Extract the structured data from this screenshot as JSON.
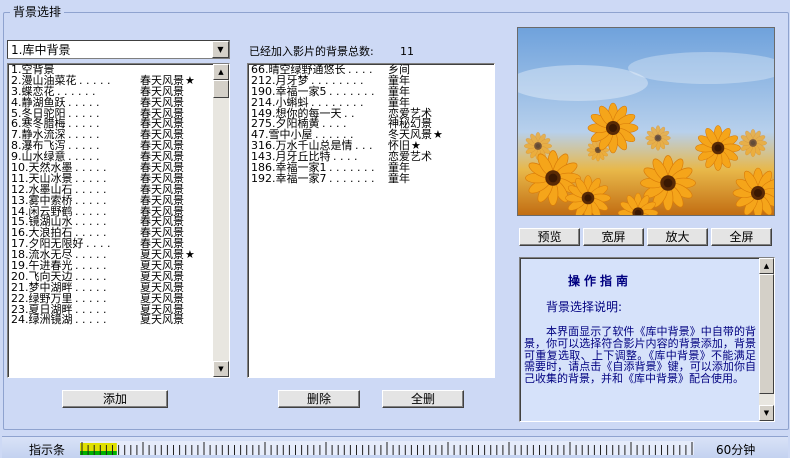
{
  "group_title": "背景选排",
  "combo": {
    "selected": "1.库中背景"
  },
  "library_list": [
    {
      "title": "1.空背景",
      "dots": "",
      "category": "",
      "star": false
    },
    {
      "title": "2.漫山油菜花",
      "dots": ". . . . .",
      "category": "春天风景",
      "star": true
    },
    {
      "title": "3.蝶恋花",
      "dots": ". . . . . .",
      "category": "春天风景",
      "star": false
    },
    {
      "title": "4.静湖鱼跃",
      "dots": ". . . . .",
      "category": "春天风景",
      "star": false
    },
    {
      "title": "5.冬日驼阳",
      "dots": ". . . . .",
      "category": "春天风景",
      "star": false
    },
    {
      "title": "6.寒冬腊梅",
      "dots": ". . . . .",
      "category": "春天风景",
      "star": false
    },
    {
      "title": "7.静水流深",
      "dots": ". . . . .",
      "category": "春天风景",
      "star": false
    },
    {
      "title": "8.瀑布飞泻",
      "dots": ". . . . .",
      "category": "春天风景",
      "star": false
    },
    {
      "title": "9.山水绿意",
      "dots": ". . . . .",
      "category": "春天风景",
      "star": false
    },
    {
      "title": "10.天然水墨",
      "dots": ". . . . .",
      "category": "春天风景",
      "star": false
    },
    {
      "title": "11.天山冰景",
      "dots": ". . . . .",
      "category": "春天风景",
      "star": false
    },
    {
      "title": "12.水墨山石",
      "dots": ". . . . .",
      "category": "春天风景",
      "star": false
    },
    {
      "title": "13.雾中索桥",
      "dots": ". . . . .",
      "category": "春天风景",
      "star": false
    },
    {
      "title": "14.闲云野鹤",
      "dots": ". . . . .",
      "category": "春天风景",
      "star": false
    },
    {
      "title": "15.镜湖山水",
      "dots": ". . . . .",
      "category": "春天风景",
      "star": false
    },
    {
      "title": "16.大浪拍石",
      "dots": ". . . . .",
      "category": "春天风景",
      "star": false
    },
    {
      "title": "17.夕阳无限好",
      "dots": ". . . .",
      "category": "春天风景",
      "star": false
    },
    {
      "title": "18.流水无尽",
      "dots": ". . . . .",
      "category": "夏天风景",
      "star": true
    },
    {
      "title": "19.午进春光",
      "dots": ". . . . .",
      "category": "夏天风景",
      "star": false
    },
    {
      "title": "20.飞向天边",
      "dots": ". . . . .",
      "category": "夏天风景",
      "star": false
    },
    {
      "title": "21.梦中湖畔",
      "dots": ". . . . .",
      "category": "夏天风景",
      "star": false
    },
    {
      "title": "22.绿野万里",
      "dots": ". . . . .",
      "category": "夏天风景",
      "star": false
    },
    {
      "title": "23.夏日湖畔",
      "dots": ". . . . .",
      "category": "夏天风景",
      "star": false
    },
    {
      "title": "24.绿洲镜湖",
      "dots": ". . . . .",
      "category": "夏天风景",
      "star": false
    }
  ],
  "added_label": "已经加入影片的背景总数:",
  "added_count": "11",
  "added_list": [
    {
      "title": "66.晴空绿野通悠长",
      "dots": ". . . .",
      "category": "乡间",
      "star": false
    },
    {
      "title": "212.月牙梦",
      "dots": ". . . . . . . .",
      "category": "童年",
      "star": false
    },
    {
      "title": "190.幸福一家5",
      "dots": ". . . . . . .",
      "category": "童年",
      "star": false
    },
    {
      "title": "214.小蝌蚪",
      "dots": ". . . . . . . .",
      "category": "童年",
      "star": false
    },
    {
      "title": "149.想你的每一天",
      "dots": ". .",
      "category": "恋爱艺术",
      "star": false
    },
    {
      "title": "275.夕阳楠黄",
      "dots": ". . . .",
      "category": "神秘幻景",
      "star": false
    },
    {
      "title": "47.雪中小屋",
      "dots": ". . . . . .",
      "category": "冬天风景",
      "star": true
    },
    {
      "title": "316.万水千山总是情",
      "dots": ". . .",
      "category": "怀旧",
      "star": true
    },
    {
      "title": "143.月牙丘比特",
      "dots": ". . . .",
      "category": "恋爱艺术",
      "star": false
    },
    {
      "title": "186.幸福一家1",
      "dots": ". . . . . . .",
      "category": "童年",
      "star": false
    },
    {
      "title": "192.幸福一家7",
      "dots": ". . . . . . .",
      "category": "童年",
      "star": false
    }
  ],
  "buttons": {
    "add": "添加",
    "delete": "删除",
    "delete_all": "全删",
    "preview": "预览",
    "widescreen": "宽屏",
    "zoom": "放大",
    "fullscreen": "全屏"
  },
  "guide": {
    "title": "操作指南",
    "subtitle": "背景选择说明:",
    "body": "本界面显示了软件《库中背景》中自带的背景，你可以选择符合影片内容的背景添加，背景可重复选取、上下调整。《库中背景》不能满足需要时，请点击《自添背景》键，可以添加你自己收集的背景，并和《库中背景》配合使用。"
  },
  "indicator": {
    "label": "指示条",
    "time": "60分钟",
    "progress_fraction": 0.06
  },
  "colors": {
    "background": "#cdd9f5",
    "guide_text": "#000080",
    "indicator_fill": "#e0e000",
    "indicator_green": "#00b000"
  }
}
